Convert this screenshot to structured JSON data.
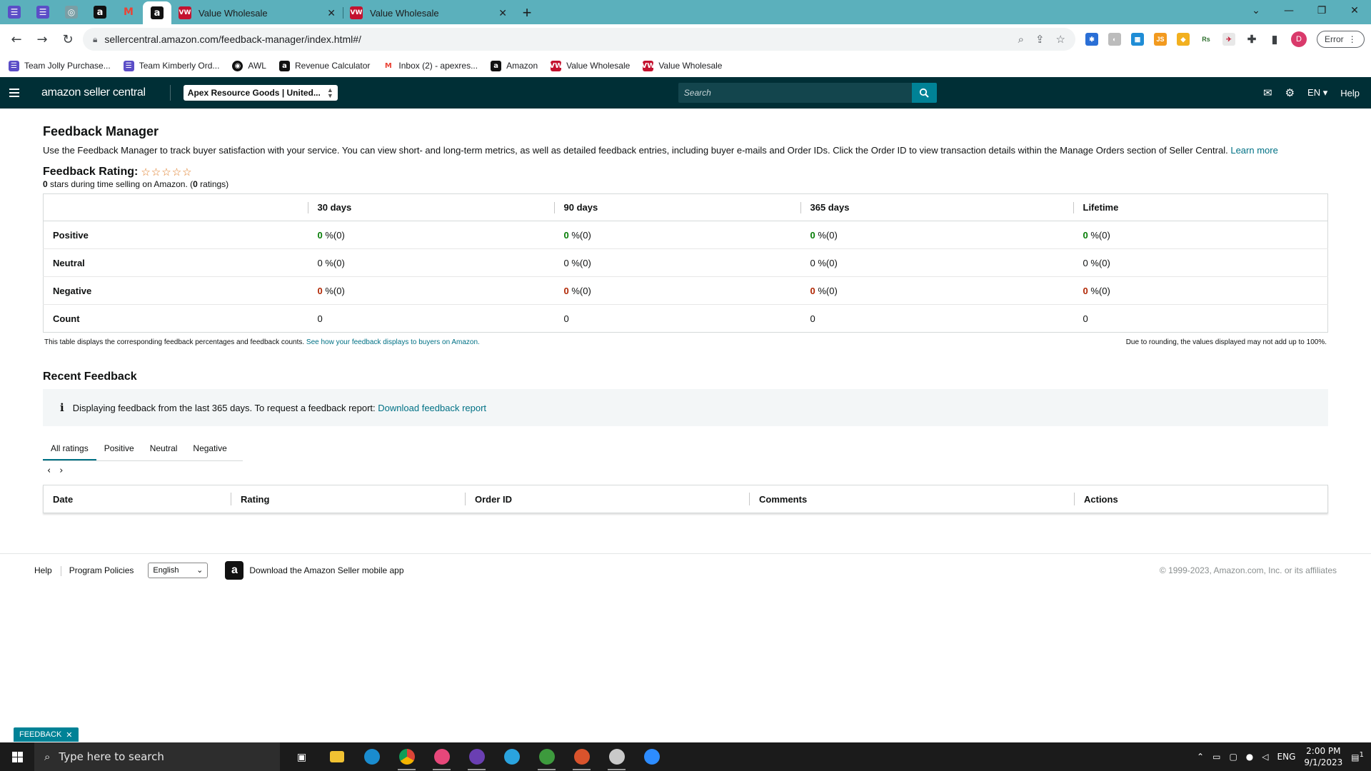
{
  "browser": {
    "tabs": [
      {
        "label": "Value Wholesale"
      },
      {
        "label": "Value Wholesale"
      }
    ],
    "url": "sellercentral.amazon.com/feedback-manager/index.html#/",
    "profile_initial": "D",
    "error_label": "Error",
    "bookmarks": [
      {
        "label": "Team Jolly Purchase...",
        "icon": "list-icon"
      },
      {
        "label": "Team Kimberly Ord...",
        "icon": "list-icon"
      },
      {
        "label": "AWL",
        "icon": "globe-icon"
      },
      {
        "label": "Revenue Calculator",
        "icon": "amazon-icon"
      },
      {
        "label": "Inbox (2) - apexres...",
        "icon": "gmail-icon"
      },
      {
        "label": "Amazon",
        "icon": "amazon-icon"
      },
      {
        "label": "Value Wholesale",
        "icon": "vw-icon"
      },
      {
        "label": "Value Wholesale",
        "icon": "vw-icon"
      }
    ]
  },
  "header": {
    "logo": "amazon seller central",
    "store": "Apex Resource Goods | United...",
    "search_placeholder": "Search",
    "language": "EN",
    "help": "Help"
  },
  "page": {
    "title": "Feedback Manager",
    "intro": "Use the Feedback Manager to track buyer satisfaction with your service. You can view short- and long-term metrics, as well as detailed feedback entries, including buyer e-mails and Order IDs. Click the Order ID to view transaction details within the Manage Orders section of Seller Central.",
    "learn_more": "Learn more",
    "rating_title": "Feedback Rating:",
    "stars": "☆☆☆☆☆",
    "rating_stars": "0",
    "rating_sub_mid": " stars during time selling on Amazon. (",
    "rating_count": "0",
    "rating_sub_end": " ratings)"
  },
  "feedback_table": {
    "columns": [
      "30 days",
      "90 days",
      "365 days",
      "Lifetime"
    ],
    "rows": [
      {
        "label": "Positive",
        "type": "pos",
        "values": [
          {
            "num": "0",
            "rest": " %(0)"
          },
          {
            "num": "0",
            "rest": " %(0)"
          },
          {
            "num": "0",
            "rest": " %(0)"
          },
          {
            "num": "0",
            "rest": " %(0)"
          }
        ]
      },
      {
        "label": "Neutral",
        "type": "neu",
        "values": [
          {
            "num": "0",
            "rest": " %(0)"
          },
          {
            "num": "0",
            "rest": " %(0)"
          },
          {
            "num": "0",
            "rest": " %(0)"
          },
          {
            "num": "0",
            "rest": " %(0)"
          }
        ]
      },
      {
        "label": "Negative",
        "type": "neg",
        "values": [
          {
            "num": "0",
            "rest": " %(0)"
          },
          {
            "num": "0",
            "rest": " %(0)"
          },
          {
            "num": "0",
            "rest": " %(0)"
          },
          {
            "num": "0",
            "rest": " %(0)"
          }
        ]
      },
      {
        "label": "Count",
        "type": "cnt",
        "values": [
          {
            "num": "0",
            "rest": ""
          },
          {
            "num": "0",
            "rest": ""
          },
          {
            "num": "0",
            "rest": ""
          },
          {
            "num": "0",
            "rest": ""
          }
        ]
      }
    ],
    "note_left": "This table displays the corresponding feedback percentages and feedback counts.",
    "note_link": "See how your feedback displays to buyers on Amazon.",
    "note_right": "Due to rounding, the values displayed may not add up to 100%."
  },
  "recent": {
    "title": "Recent Feedback",
    "info_text": "Displaying feedback from the last 365 days. To request a feedback report:",
    "info_link": "Download feedback report",
    "tabs": [
      "All ratings",
      "Positive",
      "Neutral",
      "Negative"
    ],
    "active_tab": "All ratings",
    "columns": [
      "Date",
      "Rating",
      "Order ID",
      "Comments",
      "Actions"
    ]
  },
  "footer": {
    "help": "Help",
    "policies": "Program Policies",
    "language": "English",
    "app_text": "Download the Amazon Seller mobile app",
    "copyright": "© 1999-2023, Amazon.com, Inc. or its affiliates"
  },
  "feedback_button": "FEEDBACK",
  "taskbar": {
    "search_placeholder": "Type here to search",
    "language": "ENG",
    "time": "2:00 PM",
    "date": "9/1/2023",
    "notifications": "1"
  },
  "colors": {
    "brand_dark": "#002f36",
    "accent": "#008296",
    "link": "#007185",
    "positive": "#067d06",
    "negative": "#b12704"
  }
}
